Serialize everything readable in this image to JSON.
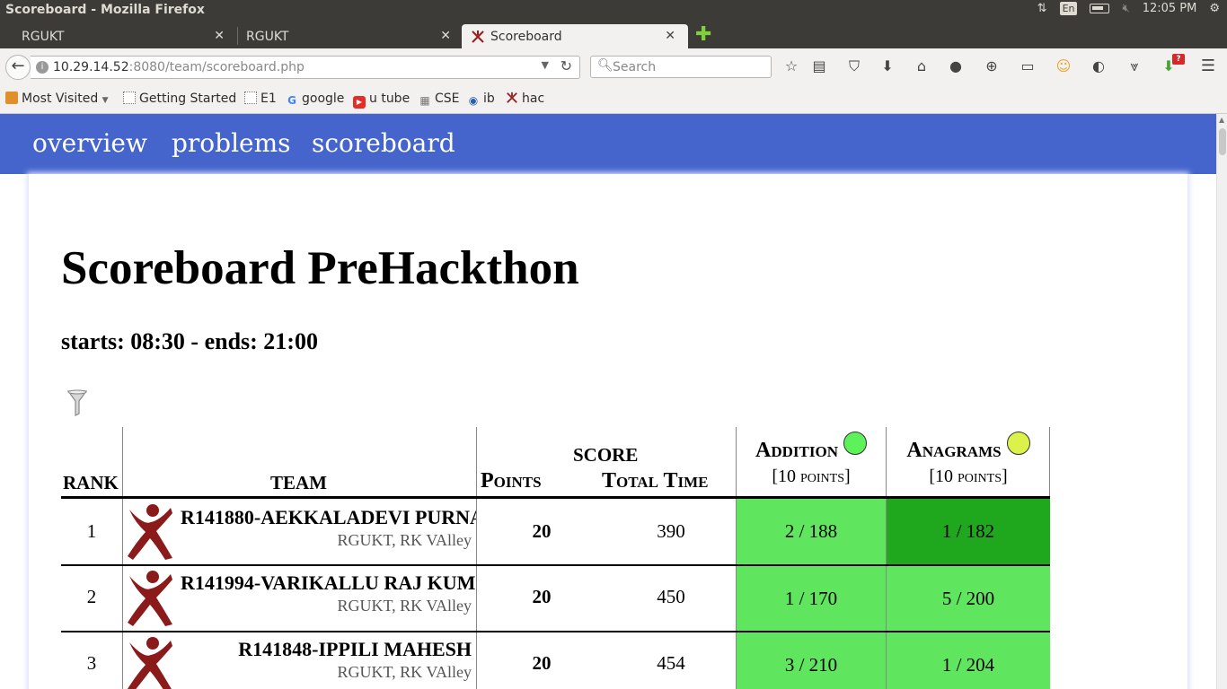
{
  "os": {
    "window_title": "Scoreboard - Mozilla Firefox",
    "lang": "En",
    "time": "12:05 PM"
  },
  "tabs": [
    {
      "label": "RGUKT"
    },
    {
      "label": "RGUKT"
    },
    {
      "label": "Scoreboard"
    }
  ],
  "navbar": {
    "url_host": "10.29.14.52",
    "url_rest": ":8080/team/scoreboard.php",
    "search_placeholder": "Search",
    "notification_badge": "?"
  },
  "bookmarks": [
    {
      "label": "Most Visited",
      "icon": "most-visited-icon"
    },
    {
      "label": "Getting Started",
      "icon": "page-icon"
    },
    {
      "label": "E1",
      "icon": "page-icon"
    },
    {
      "label": "google",
      "icon": "google-icon"
    },
    {
      "label": "u tube",
      "icon": "youtube-icon"
    },
    {
      "label": "CSE",
      "icon": "cse-icon"
    },
    {
      "label": "ib",
      "icon": "eye-icon"
    },
    {
      "label": "hac",
      "icon": "domjudge-icon"
    }
  ],
  "site_nav": [
    {
      "label": "overview"
    },
    {
      "label": "problems"
    },
    {
      "label": "scoreboard"
    }
  ],
  "page": {
    "title": "Scoreboard PreHackthon",
    "subtitle": "starts: 08:30 - ends: 21:00"
  },
  "table": {
    "headers": {
      "rank": "rank",
      "team": "team",
      "score": "score",
      "points": "Points",
      "total_time": "Total Time"
    },
    "problems": [
      {
        "name": "Addition",
        "points_label": "[10 points]",
        "balloon_color": "#5df15a"
      },
      {
        "name": "Anagrams",
        "points_label": "[10 points]",
        "balloon_color": "#dcf14a"
      }
    ],
    "rows": [
      {
        "rank": "1",
        "team": "R141880-AEKKALADEVI PURNA",
        "affiliation": "RGUKT, RK VAlley",
        "points": "20",
        "time": "390",
        "results": [
          {
            "text": "2 / 188",
            "color": "#5fe55e"
          },
          {
            "text": "1 / 182",
            "color": "#1fa71d"
          }
        ]
      },
      {
        "rank": "2",
        "team": "R141994-VARIKALLU RAJ KUM",
        "affiliation": "RGUKT, RK VAlley",
        "points": "20",
        "time": "450",
        "results": [
          {
            "text": "1 / 170",
            "color": "#5fe55e"
          },
          {
            "text": "5 / 200",
            "color": "#5fe55e"
          }
        ]
      },
      {
        "rank": "3",
        "team": "R141848-IPPILI MAHESH",
        "affiliation": "RGUKT, RK VAlley",
        "points": "20",
        "time": "454",
        "results": [
          {
            "text": "3 / 210",
            "color": "#5fe55e"
          },
          {
            "text": "1 / 204",
            "color": "#5fe55e"
          }
        ]
      }
    ]
  }
}
